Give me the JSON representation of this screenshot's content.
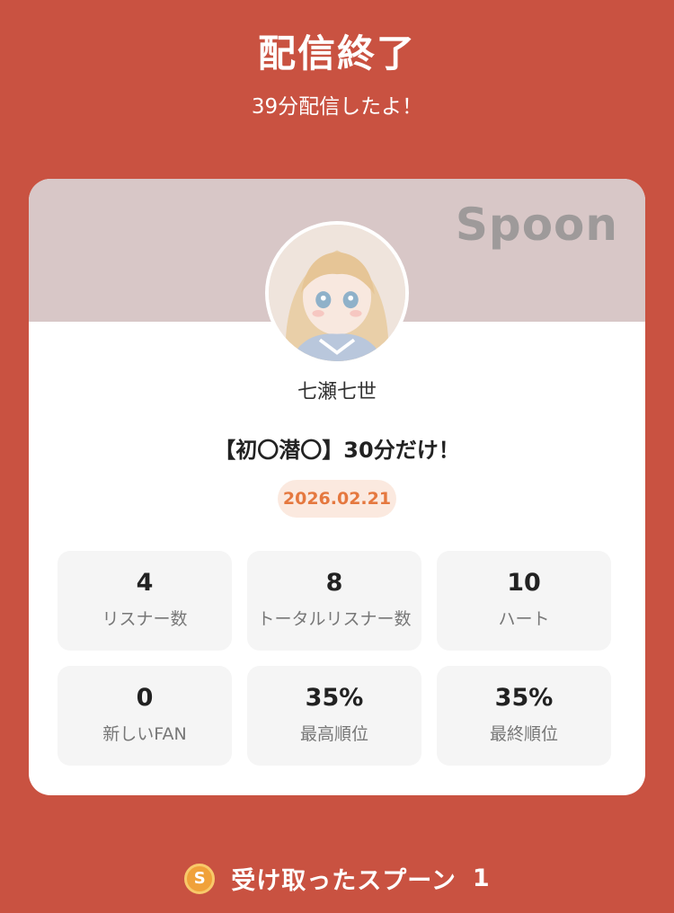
{
  "header": {
    "title": "配信終了",
    "subtitle": "39分配信したよ！"
  },
  "card": {
    "brand": "Spoon",
    "username": "七瀬七世",
    "stream_title": "【初〇潜〇】30分だけ！",
    "date": "2026.02.21",
    "stats": [
      {
        "value": "4",
        "label": "リスナー数"
      },
      {
        "value": "8",
        "label": "トータルリスナー数"
      },
      {
        "value": "10",
        "label": "ハート"
      },
      {
        "value": "0",
        "label": "新しいFAN"
      },
      {
        "value": "35%",
        "label": "最高順位"
      },
      {
        "value": "35%",
        "label": "最終順位"
      }
    ]
  },
  "footer": {
    "coin_icon": "spoon-coin-icon",
    "coin_letter": "S",
    "received_label": "受け取ったスプーン",
    "received_count": "1"
  },
  "colors": {
    "background": "#c95241",
    "card_header": "#d8c7c7",
    "date_badge_bg": "#fbe9df",
    "date_badge_text": "#e5783f",
    "stat_bg": "#f5f5f5",
    "coin": "#f0a13a"
  }
}
